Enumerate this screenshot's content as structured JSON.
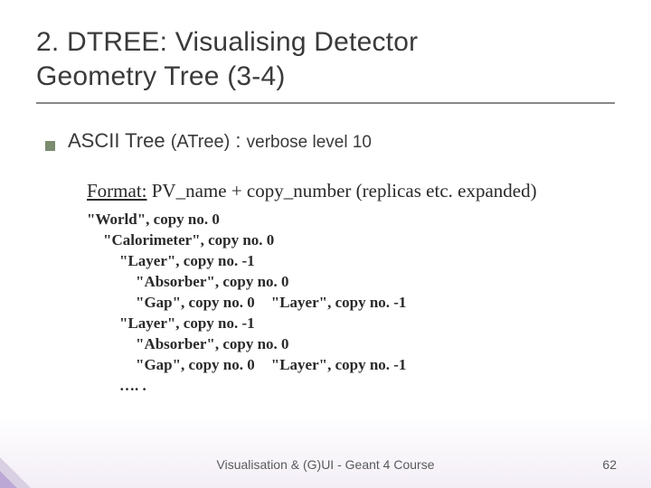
{
  "title_line1": "2. DTREE: Visualising Detector",
  "title_line2": "Geometry Tree (3-4)",
  "bullet": {
    "main": "ASCII Tree",
    "paren": "(ATree)",
    "colon": " : ",
    "verbose": "verbose level 10"
  },
  "format": {
    "label": "Format:",
    "rest": "  PV_name + copy_number  (replicas etc. expanded)"
  },
  "tree": {
    "l0": "\"World\", copy no. 0",
    "l1": "\"Calorimeter\", copy no. 0",
    "l2": "\"Layer\", copy no. -1",
    "l3": "\"Absorber\", copy no. 0",
    "l4a": "\"Gap\", copy no. 0",
    "l4b": "\"Layer\", copy no. -1",
    "l5": "\"Layer\", copy no. -1",
    "l6": "\"Absorber\", copy no. 0",
    "l7a": "\"Gap\", copy no. 0",
    "l7b": "\"Layer\", copy no. -1",
    "l8": "…. ."
  },
  "footer": {
    "center": "Visualisation & (G)UI - Geant 4 Course",
    "page": "62"
  }
}
